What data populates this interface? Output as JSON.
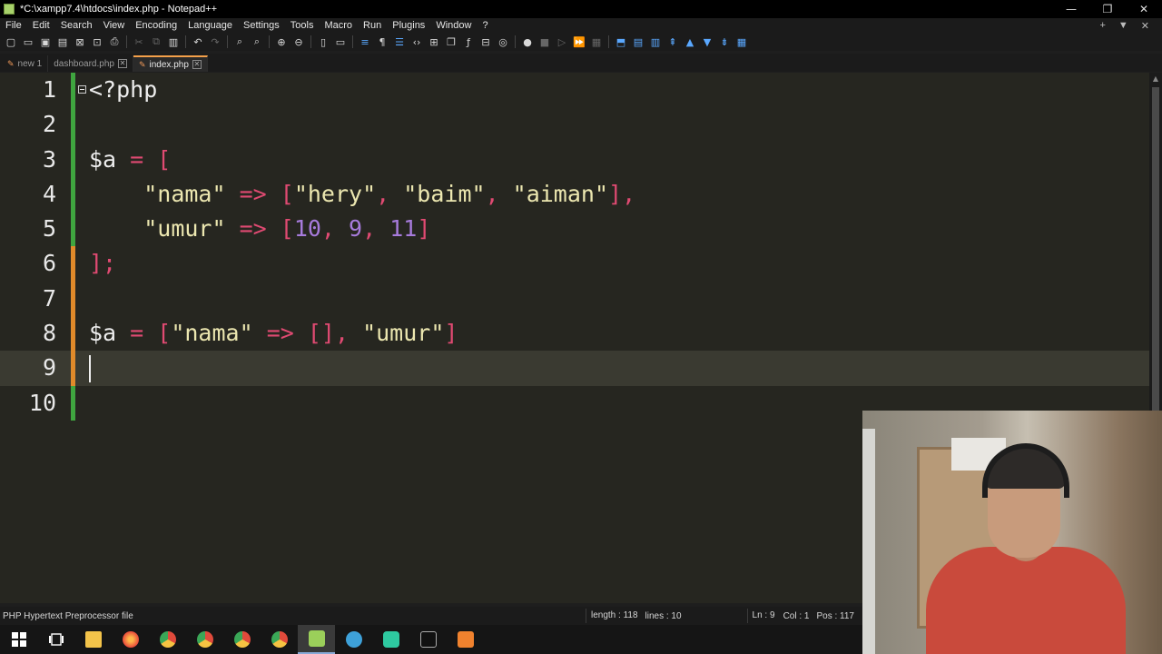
{
  "window": {
    "title": "*C:\\xampp7.4\\htdocs\\index.php - Notepad++",
    "controls": [
      "—",
      "❐",
      "✕"
    ]
  },
  "menu": {
    "items": [
      "File",
      "Edit",
      "Search",
      "View",
      "Encoding",
      "Language",
      "Settings",
      "Tools",
      "Macro",
      "Run",
      "Plugins",
      "Window",
      "?"
    ],
    "right": [
      "+",
      "▼",
      "✕"
    ]
  },
  "tabs": [
    {
      "label": "new 1",
      "active": false
    },
    {
      "label": "dashboard.php",
      "active": false
    },
    {
      "label": "index.php",
      "active": true
    }
  ],
  "editor": {
    "lines": [
      {
        "num": "1",
        "tokens": [
          {
            "t": "<?php",
            "c": "tag"
          }
        ]
      },
      {
        "num": "2",
        "tokens": []
      },
      {
        "num": "3",
        "tokens": [
          {
            "t": "$a",
            "c": "var"
          },
          {
            "t": " = ",
            "c": "op"
          },
          {
            "t": "[",
            "c": "op"
          }
        ]
      },
      {
        "num": "4",
        "tokens": [
          {
            "t": "    ",
            "c": "var"
          },
          {
            "t": "\"nama\"",
            "c": "str"
          },
          {
            "t": " => ",
            "c": "op"
          },
          {
            "t": "[",
            "c": "op"
          },
          {
            "t": "\"hery\"",
            "c": "str"
          },
          {
            "t": ", ",
            "c": "op"
          },
          {
            "t": "\"baim\"",
            "c": "str"
          },
          {
            "t": ", ",
            "c": "op"
          },
          {
            "t": "\"aiman\"",
            "c": "str"
          },
          {
            "t": "],",
            "c": "op"
          }
        ]
      },
      {
        "num": "5",
        "tokens": [
          {
            "t": "    ",
            "c": "var"
          },
          {
            "t": "\"umur\"",
            "c": "str"
          },
          {
            "t": " => ",
            "c": "op"
          },
          {
            "t": "[",
            "c": "op"
          },
          {
            "t": "10",
            "c": "num"
          },
          {
            "t": ", ",
            "c": "op"
          },
          {
            "t": "9",
            "c": "num"
          },
          {
            "t": ", ",
            "c": "op"
          },
          {
            "t": "11",
            "c": "num"
          },
          {
            "t": "]",
            "c": "op"
          }
        ]
      },
      {
        "num": "6",
        "tokens": [
          {
            "t": "];",
            "c": "op"
          }
        ]
      },
      {
        "num": "7",
        "tokens": []
      },
      {
        "num": "8",
        "tokens": [
          {
            "t": "$a",
            "c": "var"
          },
          {
            "t": " = ",
            "c": "op"
          },
          {
            "t": "[",
            "c": "op"
          },
          {
            "t": "\"nama\"",
            "c": "str"
          },
          {
            "t": " => ",
            "c": "op"
          },
          {
            "t": "[]",
            "c": "op"
          },
          {
            "t": ", ",
            "c": "op"
          },
          {
            "t": "\"umur\"",
            "c": "str"
          },
          {
            "t": "]",
            "c": "op"
          }
        ]
      },
      {
        "num": "9",
        "tokens": [],
        "current": true
      },
      {
        "num": "10",
        "tokens": []
      }
    ],
    "change_marks": {
      "1": "#3fa53f",
      "2": "#3fa53f",
      "3": "#3fa53f",
      "4": "#3fa53f",
      "5": "#3fa53f",
      "6": "#e08a2a",
      "7": "#e08a2a",
      "8": "#e08a2a",
      "9": "#e08a2a",
      "10": "#3fa53f"
    }
  },
  "status": {
    "language": "PHP Hypertext Preprocessor file",
    "length": "length : 118",
    "lines": "lines : 10",
    "ln": "Ln : 9",
    "col": "Col : 1",
    "pos": "Pos : 117"
  },
  "colors": {
    "string": "#ece7b0",
    "operator": "#e04a72",
    "number": "#a77bdc",
    "editor_bg": "#262620"
  },
  "taskbar": {
    "icons": [
      "windows-start-icon",
      "task-view-icon",
      "file-explorer-icon",
      "firefox-icon",
      "chrome-icon",
      "chrome-icon-2",
      "chrome-icon-3",
      "chrome-icon-4",
      "notepad-plus-plus-icon",
      "telegram-icon",
      "app-icon",
      "terminal-icon",
      "xampp-icon"
    ]
  }
}
